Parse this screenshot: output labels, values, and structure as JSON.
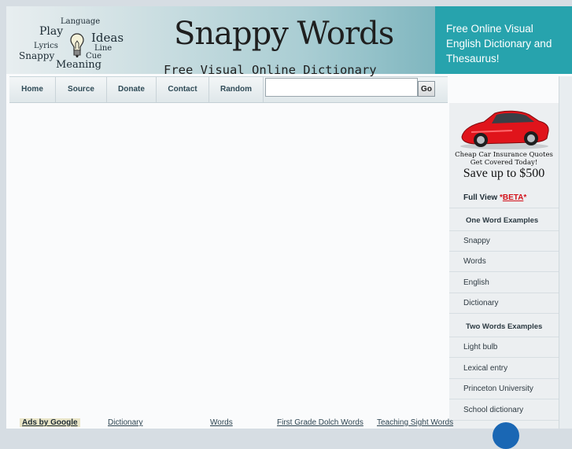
{
  "logo": {
    "words": [
      "Language",
      "Play",
      "Ideas",
      "Lyrics",
      "Line",
      "Snappy",
      "Cue",
      "Meaning"
    ],
    "icon": "lightbulb-icon"
  },
  "header": {
    "title": "Snappy Words",
    "subtitle": "Free Visual Online Dictionary",
    "tagline": "Free Online Visual English Dictionary and Thesaurus!"
  },
  "nav": {
    "items": [
      "Home",
      "Source",
      "Donate",
      "Contact",
      "Random"
    ]
  },
  "search": {
    "value": "",
    "placeholder": "",
    "button_label": "Go"
  },
  "sidebar": {
    "ad": {
      "image": "red-car",
      "line1": "Cheap Car Insurance Quotes",
      "line2": "Get Covered Today!",
      "line3": "Save up to $500"
    },
    "full_view": {
      "label": "Full View ",
      "star_left": "*",
      "beta": "BETA",
      "star_right": "*"
    },
    "one_word_heading": "One Word Examples",
    "one_word": [
      "Snappy",
      "Words",
      "English",
      "Dictionary"
    ],
    "two_word_heading": "Two Words Examples",
    "two_word": [
      "Light bulb",
      "Lexical entry",
      "Princeton University",
      "School dictionary"
    ]
  },
  "ads_bar": {
    "ads_by": "Ads by Google",
    "links": [
      "Dictionary",
      "Words",
      "First Grade Dolch Words",
      "Teaching Sight Words"
    ]
  },
  "colors": {
    "tagline_bg": "#27a3ad",
    "beta": "#d3121b",
    "car": "#e0141b"
  }
}
